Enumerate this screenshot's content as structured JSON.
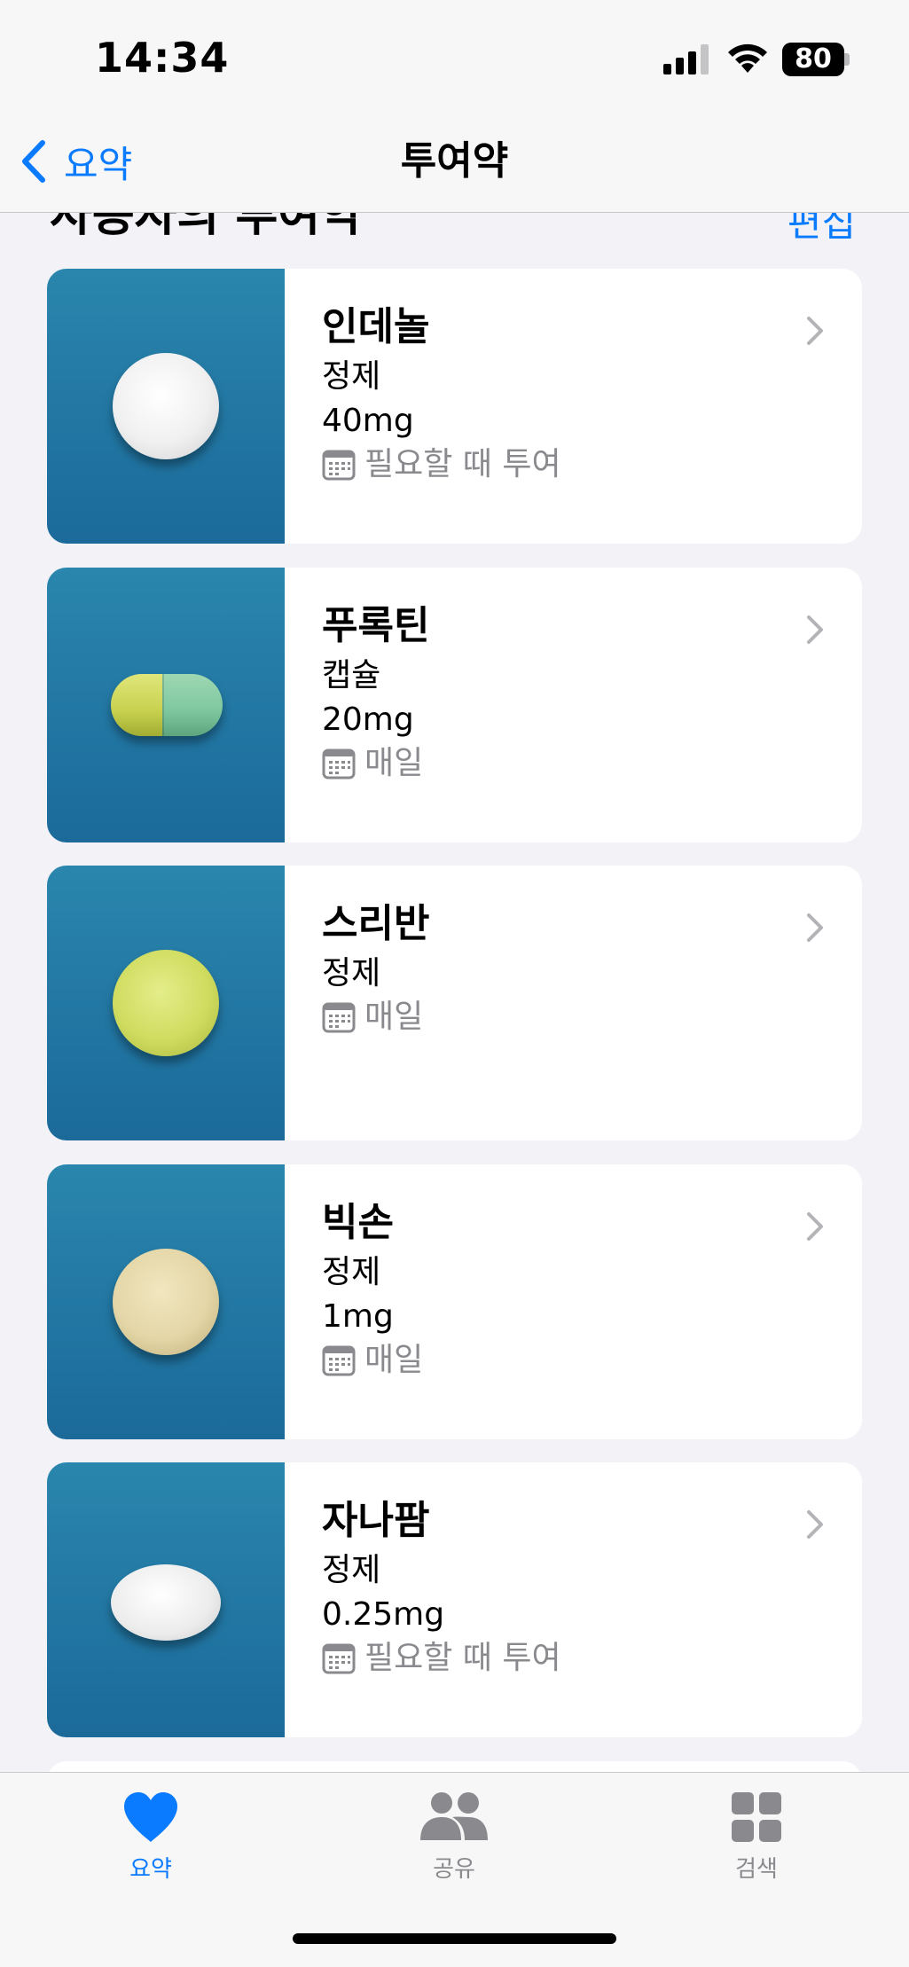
{
  "status_bar": {
    "time": "14:34",
    "battery_level": "80"
  },
  "nav": {
    "back_label": "요약",
    "title": "투여약"
  },
  "section": {
    "title": "사용자의 투여약",
    "edit_label": "편집"
  },
  "medications": [
    {
      "name": "인데놀",
      "form": "정제",
      "dose": "40mg",
      "schedule": "필요할 때 투여",
      "pill_shape": "round",
      "pill_color": "#f0f0f0"
    },
    {
      "name": "푸록틴",
      "form": "캡슐",
      "dose": "20mg",
      "schedule": "매일",
      "pill_shape": "capsule",
      "pill_color": "#cfdc5f",
      "pill_color_2": "#7ec79e"
    },
    {
      "name": "스리반",
      "form": "정제",
      "dose": "",
      "schedule": "매일",
      "pill_shape": "round",
      "pill_color": "#cfdc5f"
    },
    {
      "name": "빅손",
      "form": "정제",
      "dose": "1mg",
      "schedule": "매일",
      "pill_shape": "round",
      "pill_color": "#e4d6a7"
    },
    {
      "name": "자나팜",
      "form": "정제",
      "dose": "0.25mg",
      "schedule": "필요할 때 투여",
      "pill_shape": "oval",
      "pill_color": "#ececec"
    }
  ],
  "tab_bar": {
    "tabs": [
      {
        "label": "요약",
        "icon": "heart-icon",
        "active": true
      },
      {
        "label": "공유",
        "icon": "people-icon",
        "active": false
      },
      {
        "label": "검색",
        "icon": "grid-icon",
        "active": false
      }
    ]
  },
  "colors": {
    "accent": "#0a7bff",
    "thumb_bg": "#1f74a2",
    "background": "#f2f2f7"
  }
}
